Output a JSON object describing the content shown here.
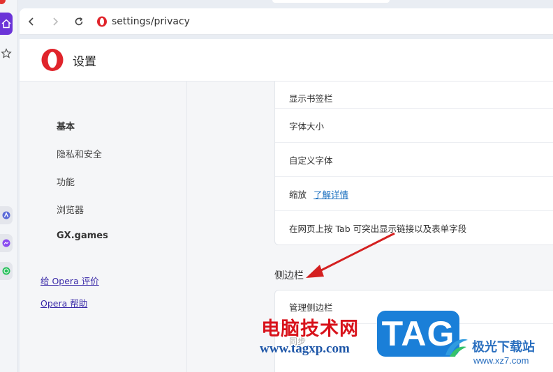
{
  "browser": {
    "url": "settings/privacy",
    "accent": "#6b34d8"
  },
  "settings": {
    "title": "设置"
  },
  "nav": {
    "items": [
      {
        "label": "基本",
        "active": true
      },
      {
        "label": "隐私和安全",
        "active": false
      },
      {
        "label": "功能",
        "active": false
      },
      {
        "label": "浏览器",
        "active": false
      },
      {
        "label": "GX.games",
        "active": true
      }
    ],
    "links": [
      {
        "label": "给 Opera 评价"
      },
      {
        "label": "Opera 帮助"
      }
    ]
  },
  "appearance": {
    "rows": [
      {
        "label": "显示书签栏"
      },
      {
        "label": "字体大小"
      },
      {
        "label": "自定义字体"
      },
      {
        "label": "缩放",
        "link": "了解详情"
      },
      {
        "label": "在网页上按 Tab 可突出显示链接以及表单字段"
      }
    ]
  },
  "sidebar_section": {
    "title": "侧边栏",
    "rows": [
      {
        "label": "管理侧边栏"
      },
      {
        "label": "同步"
      }
    ]
  },
  "watermark": {
    "cn_text": "电脑技术网",
    "url": "www.tagxp.com",
    "tag": "TAG",
    "site_cn": "极光下载站",
    "site_url": "www.xz7.com",
    "red": "#d8121b",
    "blue": "#1a7fd8"
  },
  "annotation": {
    "arrow_color": "#d42020"
  }
}
